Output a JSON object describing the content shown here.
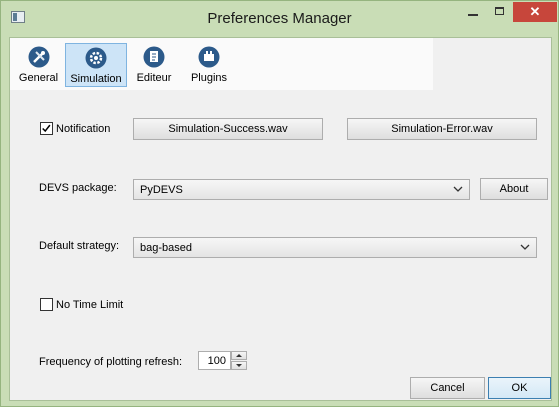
{
  "window": {
    "title": "Preferences Manager"
  },
  "toolbar": {
    "tabs": [
      {
        "label": "General",
        "icon": "tools-icon"
      },
      {
        "label": "Simulation",
        "icon": "gear-icon",
        "active": true
      },
      {
        "label": "Editeur",
        "icon": "editor-icon"
      },
      {
        "label": "Plugins",
        "icon": "plugin-icon"
      }
    ]
  },
  "simulation": {
    "notification": {
      "label": "Notification",
      "checked": true
    },
    "success_sound_button": "Simulation-Success.wav",
    "error_sound_button": "Simulation-Error.wav",
    "devs_package": {
      "label": "DEVS package:",
      "value": "PyDEVS",
      "about_button": "About"
    },
    "default_strategy": {
      "label": "Default strategy:",
      "value": "bag-based"
    },
    "no_time_limit": {
      "label": "No Time Limit",
      "checked": false
    },
    "plot_refresh": {
      "label": "Frequency of plotting refresh:",
      "value": "100"
    }
  },
  "footer": {
    "cancel": "Cancel",
    "ok": "OK"
  },
  "colors": {
    "title_bg": "#c9ddb6",
    "close_red": "#c7463b",
    "active_tab": "#cde4f7",
    "accent": "#3c7fb1"
  }
}
